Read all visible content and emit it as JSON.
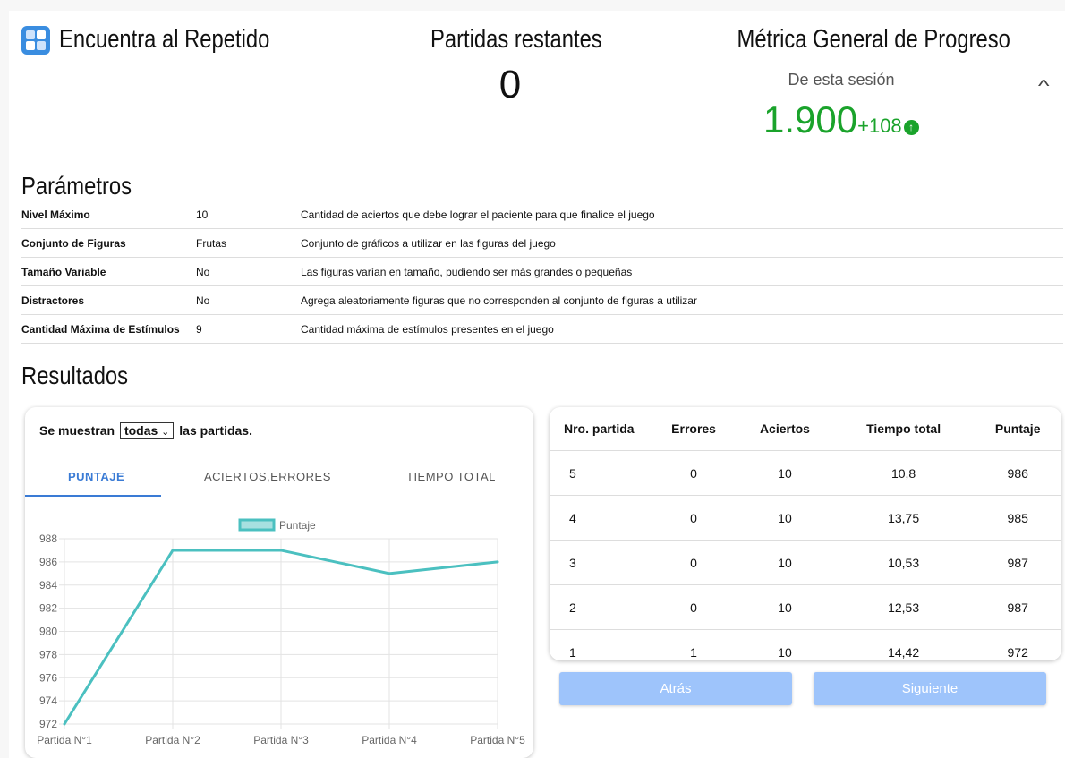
{
  "header": {
    "app_title": "Encuentra al Repetido",
    "remaining_label": "Partidas restantes",
    "remaining_value": "0",
    "metric_title": "Métrica General de Progreso",
    "metric_sub": "De esta sesión",
    "metric_value": "1.900",
    "metric_delta": "+108"
  },
  "params": {
    "heading": "Parámetros",
    "rows": [
      {
        "name": "Nivel Máximo",
        "value": "10",
        "desc": "Cantidad de aciertos que debe lograr el paciente para que finalice el juego"
      },
      {
        "name": "Conjunto de Figuras",
        "value": "Frutas",
        "desc": "Conjunto de gráficos a utilizar en las figuras del juego"
      },
      {
        "name": "Tamaño Variable",
        "value": "No",
        "desc": "Las figuras varían en tamaño, pudiendo ser más grandes o pequeñas"
      },
      {
        "name": "Distractores",
        "value": "No",
        "desc": "Agrega aleatoriamente figuras que no corresponden al conjunto de figuras a utilizar"
      },
      {
        "name": "Cantidad Máxima de Estímulos",
        "value": "9",
        "desc": "Cantidad máxima de estímulos presentes en el juego"
      }
    ]
  },
  "results": {
    "heading": "Resultados",
    "filter_prefix": "Se muestran",
    "filter_value": "todas",
    "filter_suffix": "las partidas.",
    "tabs": [
      "PUNTAJE",
      "ACIERTOS,ERRORES",
      "TIEMPO TOTAL"
    ],
    "columns": [
      "Nro. partida",
      "Errores",
      "Aciertos",
      "Tiempo total",
      "Puntaje"
    ],
    "rows": [
      [
        "5",
        "0",
        "10",
        "10,8",
        "986"
      ],
      [
        "4",
        "0",
        "10",
        "13,75",
        "985"
      ],
      [
        "3",
        "0",
        "10",
        "10,53",
        "987"
      ],
      [
        "2",
        "0",
        "10",
        "12,53",
        "987"
      ],
      [
        "1",
        "1",
        "10",
        "14,42",
        "972"
      ]
    ],
    "prev_label": "Atrás",
    "next_label": "Siguiente"
  },
  "chart_data": {
    "type": "line",
    "categories": [
      "Partida N°1",
      "Partida N°2",
      "Partida N°3",
      "Partida N°4",
      "Partida N°5"
    ],
    "series": [
      {
        "name": "Puntaje",
        "values": [
          972,
          987,
          987,
          985,
          986
        ]
      }
    ],
    "ylim": [
      972,
      988
    ],
    "yticks": [
      972,
      974,
      976,
      978,
      980,
      982,
      984,
      986,
      988
    ],
    "grid": true,
    "legend": "top-center",
    "color": "#4bc0c0"
  },
  "colors": {
    "accent": "#3a7bd5",
    "positive": "#1aa32b",
    "button": "#9ec4fb"
  }
}
